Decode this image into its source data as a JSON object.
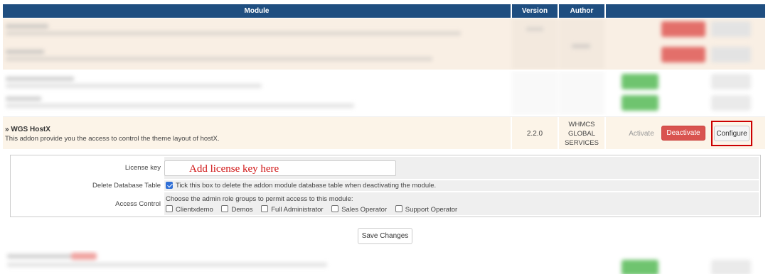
{
  "table_header": {
    "module": "Module",
    "version": "Version",
    "author": "Author"
  },
  "module": {
    "name": "» WGS HostX",
    "description": "This addon provide you the access to control the theme layout of hostX.",
    "version": "2.2.0",
    "author_lines": [
      "WHMCS",
      "GLOBAL",
      "SERVICES"
    ],
    "activate_label": "Activate",
    "deactivate_label": "Deactivate",
    "configure_label": "Configure"
  },
  "config": {
    "license_label": "License key",
    "license_hint": "Add license key here",
    "delete_db_label": "Delete Database Table",
    "delete_db_text": "Tick this box to delete the addon module database table when deactivating the module.",
    "delete_db_checked": true,
    "access_label": "Access Control",
    "access_text": "Choose the admin role groups to permit access to this module:",
    "roles": [
      "Clientxdemo",
      "Demos",
      "Full Administrator",
      "Sales Operator",
      "Support Operator"
    ]
  },
  "save_label": "Save Changes",
  "colors": {
    "header_bg": "#1f4e80",
    "highlight_row": "#fcf4e8",
    "deactivate": "#d9534f",
    "activate_green": "#5cb85c",
    "annotation_red": "#d01515"
  }
}
